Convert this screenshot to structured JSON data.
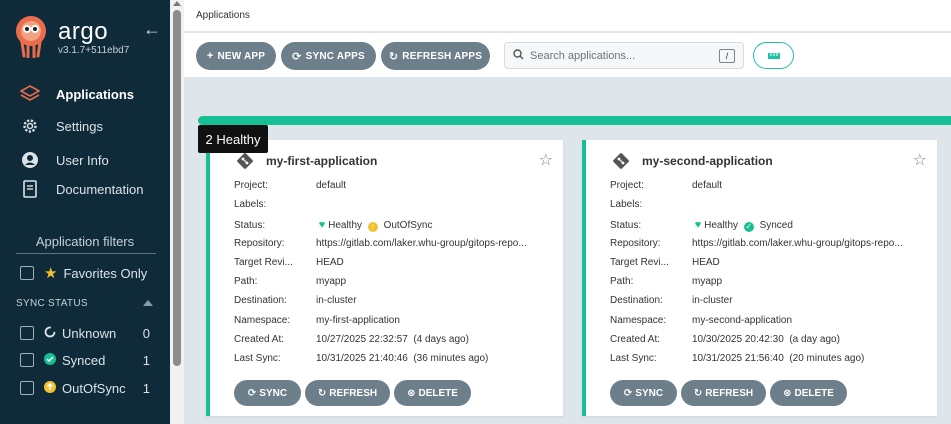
{
  "app": {
    "brand": "argo",
    "version": "v3.1.7+511ebd7"
  },
  "nav": [
    {
      "label": "Applications",
      "icon": "layers-icon"
    },
    {
      "label": "Settings",
      "icon": "gear-icon"
    },
    {
      "label": "User Info",
      "icon": "user-icon"
    },
    {
      "label": "Documentation",
      "icon": "book-icon"
    }
  ],
  "filters": {
    "title": "Application filters",
    "favorites_label": "Favorites Only",
    "sync_status_header": "SYNC STATUS",
    "sync_status": [
      {
        "label": "Unknown",
        "count": "0",
        "icon": "circle-notch-icon"
      },
      {
        "label": "Synced",
        "count": "1",
        "icon": "check-circle-icon"
      },
      {
        "label": "OutOfSync",
        "count": "1",
        "icon": "arrow-up-circle-icon"
      }
    ]
  },
  "breadcrumb": "Applications",
  "toolbar": {
    "new_app": "NEW APP",
    "sync_apps": "SYNC APPS",
    "refresh_apps": "REFRESH APPS",
    "search_placeholder": "Search applications...",
    "search_shortcut": "/"
  },
  "health_tooltip": "2 Healthy",
  "labels": {
    "project": "Project:",
    "labels": "Labels:",
    "status": "Status:",
    "repository": "Repository:",
    "target_revision": "Target Revi...",
    "path": "Path:",
    "destination": "Destination:",
    "namespace": "Namespace:",
    "created_at": "Created At:",
    "last_sync": "Last Sync:"
  },
  "buttons": {
    "sync": "SYNC",
    "refresh": "REFRESH",
    "delete": "DELETE"
  },
  "apps": [
    {
      "name": "my-first-application",
      "project": "default",
      "labels": "",
      "health": "Healthy",
      "sync": "OutOfSync",
      "repository": "https://gitlab.com/laker.whu-group/gitops-repo...",
      "target_revision": "HEAD",
      "path": "myapp",
      "destination": "in-cluster",
      "namespace": "my-first-application",
      "created_at": "10/27/2025 22:32:57",
      "created_ago": "(4 days ago)",
      "last_sync": "10/31/2025 21:40:46",
      "last_sync_ago": "(36 minutes ago)"
    },
    {
      "name": "my-second-application",
      "project": "default",
      "labels": "",
      "health": "Healthy",
      "sync": "Synced",
      "repository": "https://gitlab.com/laker.whu-group/gitops-repo...",
      "target_revision": "HEAD",
      "path": "myapp",
      "destination": "in-cluster",
      "namespace": "my-second-application",
      "created_at": "10/30/2025 20:42:30",
      "created_ago": "(a day ago)",
      "last_sync": "10/31/2025 21:56:40",
      "last_sync_ago": "(20 minutes ago)"
    }
  ],
  "colors": {
    "sidebar": "#0f2b3a",
    "healthy": "#18be94",
    "out_of_sync": "#f4c030",
    "button": "#6d7f8b",
    "accent": "#1ec2a6"
  }
}
